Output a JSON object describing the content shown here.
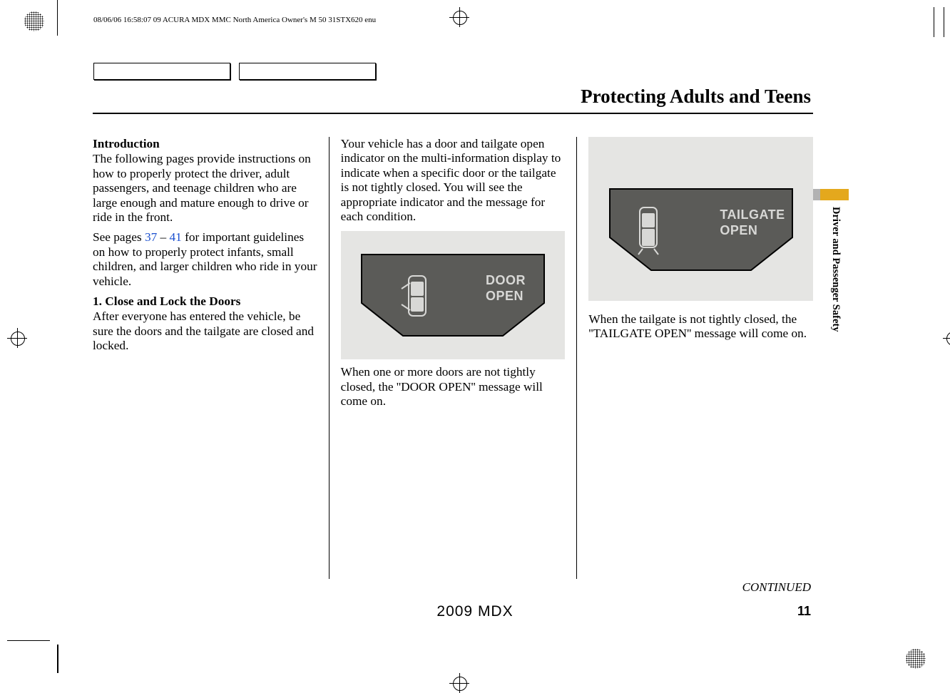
{
  "header": "08/06/06 16:58:07   09 ACURA MDX MMC North America Owner's M 50 31STX620 enu",
  "page_title": "Protecting Adults and Teens",
  "side_label": "Driver and Passenger Safety",
  "continued": "CONTINUED",
  "page_number": "11",
  "model": "2009  MDX",
  "col1": {
    "h_intro": "Introduction",
    "p_intro": "The following pages provide instructions on how to properly protect the driver, adult passengers, and teenage children who are large enough and mature enough to drive or ride in the front.",
    "see_pre": "See pages ",
    "link1": "37",
    "dash": " – ",
    "link2": "41",
    "see_post": " for important guidelines on how to properly protect infants, small children, and larger children who ride in your vehicle.",
    "step1_h": "1. Close and Lock the Doors",
    "step1_p": "After everyone has entered the vehicle, be sure the doors and the tailgate are closed and locked."
  },
  "col2": {
    "p1": "Your vehicle has a door and tailgate open indicator on the multi-information display to indicate when a specific door or the tailgate is not tightly closed. You will see the appropriate indicator and the message for each condition.",
    "fig_label_1": "DOOR",
    "fig_label_2": "OPEN",
    "p2": "When one or more doors are not tightly closed, the ''DOOR OPEN'' message will come on."
  },
  "col3": {
    "fig_label_1": "TAILGATE",
    "fig_label_2": "OPEN",
    "p1": "When the tailgate is not tightly closed, the ''TAILGATE OPEN'' message will come on."
  }
}
